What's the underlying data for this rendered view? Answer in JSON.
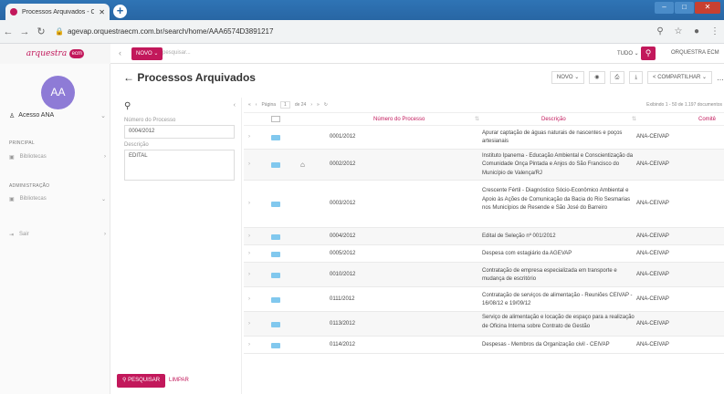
{
  "browser": {
    "tab_title": "Processos Arquivados - Orquest",
    "url": "agevap.orquestraecm.com.br/search/home/AAA6574D3891217"
  },
  "header": {
    "logo_text": "arquestra",
    "logo_badge": "ecm",
    "novo_label": "NOVO ⌄",
    "search_placeholder": "pesquisar...",
    "scope": "TUDO ⌄",
    "org": "ORQUESTRA ECM"
  },
  "sidebar": {
    "avatar": "AA",
    "acesso": "Acesso ANA",
    "sections": [
      {
        "title": "PRINCIPAL",
        "item": "Bibliotecas"
      },
      {
        "title": "ADMINISTRAÇÃO",
        "item": "Bibliotecas"
      }
    ],
    "sair": "Sair"
  },
  "page": {
    "title": "Processos Arquivados",
    "novo": "NOVO ⌄",
    "compartilhar": "COMPARTILHAR ⌄"
  },
  "filter": {
    "num_label": "Número do Processo",
    "num_value": "0004/2012",
    "desc_label": "Descrição",
    "desc_value": "EDITAL",
    "pesquisar": "PESQUISAR",
    "limpar": "LIMPAR"
  },
  "pager": {
    "pagina": "Página",
    "page_num": "1",
    "de": "de 24",
    "exibindo": "Exibindo 1 - 50 de 1.197 documentos"
  },
  "table": {
    "headers": {
      "numero": "Número do Processo",
      "descricao": "Descrição",
      "comite": "Comitê"
    },
    "rows": [
      {
        "num": "0001/2012",
        "desc": "Apurar captação de águas naturais de nascentes e poços artesianais",
        "comite": "ANA-CEIVAP"
      },
      {
        "num": "0002/2012",
        "desc": "Instituto Ipanema - Educação Ambiental e Conscientização da Comunidade Onça Pintada e Anjos do São Francisco do Município de Valença/RJ",
        "comite": "ANA-CEIVAP"
      },
      {
        "num": "0003/2012",
        "desc": "Crescente Fértil - Diagnóstico Sócio-Econômico Ambiental e Apoio às Ações de Comunicação da Bacia do Rio Sesmarias nos Municípios de Resende e São José do Barreiro",
        "comite": "ANA-CEIVAP"
      },
      {
        "num": "0004/2012",
        "desc": "Edital de Seleção nº 001/2012",
        "comite": "ANA-CEIVAP"
      },
      {
        "num": "0005/2012",
        "desc": "Despesa com estagiário da AGEVAP",
        "comite": "ANA-CEIVAP"
      },
      {
        "num": "0010/2012",
        "desc": "Contratação de empresa especializada em transporte e mudança de escritório",
        "comite": "ANA-CEIVAP"
      },
      {
        "num": "0111/2012",
        "desc": "Contratação de serviços de alimentação - Reuniões CEIVAP - 16/08/12 e 19/09/12",
        "comite": "ANA-CEIVAP"
      },
      {
        "num": "0113/2012",
        "desc": "Serviço de alimentação e locação de espaço para a realização de Oficina Interna sobre Contrato de Gestão",
        "comite": "ANA-CEIVAP"
      },
      {
        "num": "0114/2012",
        "desc": "Despesas - Membros da Organização civil - CEIVAP",
        "comite": "ANA-CEIVAP"
      }
    ]
  }
}
